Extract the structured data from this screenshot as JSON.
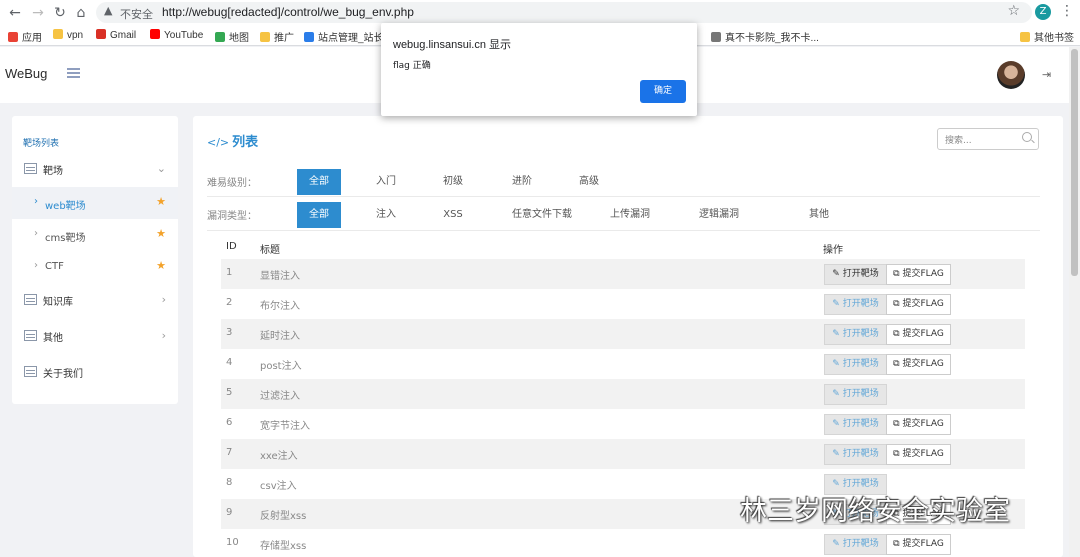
{
  "browser": {
    "warning": "不安全",
    "url": "http://webug[redacted]/control/we_bug_env.php",
    "profile_initial": "Z",
    "bookmarks": [
      {
        "label": "应用",
        "color": "#e94235"
      },
      {
        "label": "vpn",
        "color": "#f6c343"
      },
      {
        "label": "Gmail",
        "color": "#d93025"
      },
      {
        "label": "YouTube",
        "color": "#ff0000"
      },
      {
        "label": "地图",
        "color": "#34a853"
      },
      {
        "label": "推广",
        "color": "#f6c343"
      },
      {
        "label": "站点管理_站长工",
        "color": "#2b7de9"
      },
      {
        "label": "真不卡影院_我不卡...",
        "color": "#777777"
      },
      {
        "label": "其他书签",
        "color": "#f6c343"
      }
    ]
  },
  "app": {
    "brand": "WeBug",
    "sidebar": {
      "title": "靶场列表",
      "items": [
        {
          "label": "靶场"
        },
        {
          "label": "web靶场"
        },
        {
          "label": "cms靶场"
        },
        {
          "label": "CTF"
        },
        {
          "label": "知识库"
        },
        {
          "label": "其他"
        },
        {
          "label": "关于我们"
        }
      ]
    },
    "main": {
      "title": "列表",
      "search_placeholder": "搜索...",
      "difficulty_label": "难易级别：",
      "difficulty_options": [
        "全部",
        "入门",
        "初级",
        "进阶",
        "高级"
      ],
      "vuln_label": "漏洞类型：",
      "vuln_options": [
        "全部",
        "注入",
        "XSS",
        "任意文件下载",
        "上传漏洞",
        "逻辑漏洞",
        "其他"
      ],
      "columns": [
        "ID",
        "标题",
        "操作"
      ],
      "open_label": "打开靶场",
      "flag_label": "提交FLAG",
      "rows": [
        {
          "id": "1",
          "title": "显错注入"
        },
        {
          "id": "2",
          "title": "布尔注入"
        },
        {
          "id": "3",
          "title": "延时注入"
        },
        {
          "id": "4",
          "title": "post注入"
        },
        {
          "id": "5",
          "title": "过滤注入"
        },
        {
          "id": "6",
          "title": "宽字节注入"
        },
        {
          "id": "7",
          "title": "xxe注入"
        },
        {
          "id": "8",
          "title": "csv注入"
        },
        {
          "id": "9",
          "title": "反射型xss"
        },
        {
          "id": "10",
          "title": "存储型xss"
        }
      ]
    }
  },
  "dialog": {
    "title": "webug.linsansui.cn 显示",
    "message": "flag 正确",
    "ok_label": "确定"
  },
  "watermark": "林三岁网络安全实验室",
  "colors": {
    "accent": "#2d8ccf",
    "star": "#f3a22a",
    "dialog_button": "#1a73e8"
  }
}
